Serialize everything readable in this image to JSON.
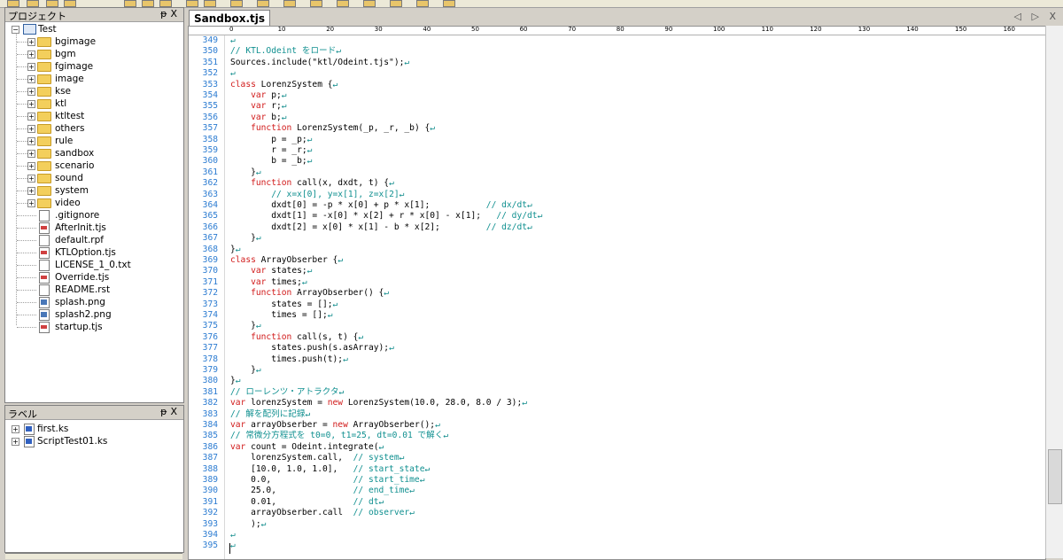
{
  "project_panel": {
    "title": "プロジェクト",
    "pin": "ᵽ",
    "close": "X",
    "root": "Test",
    "folders": [
      "bgimage",
      "bgm",
      "fgimage",
      "image",
      "kse",
      "ktl",
      "ktltest",
      "others",
      "rule",
      "sandbox",
      "scenario",
      "sound",
      "system",
      "video"
    ],
    "files": [
      {
        "name": ".gitignore",
        "kind": "txt"
      },
      {
        "name": "AfterInit.tjs",
        "kind": "tjs"
      },
      {
        "name": "default.rpf",
        "kind": "txt"
      },
      {
        "name": "KTLOption.tjs",
        "kind": "tjs"
      },
      {
        "name": "LICENSE_1_0.txt",
        "kind": "txt"
      },
      {
        "name": "Override.tjs",
        "kind": "tjs"
      },
      {
        "name": "README.rst",
        "kind": "txt"
      },
      {
        "name": "splash.png",
        "kind": "img"
      },
      {
        "name": "splash2.png",
        "kind": "img"
      },
      {
        "name": "startup.tjs",
        "kind": "tjs"
      }
    ]
  },
  "label_panel": {
    "title": "ラベル",
    "pin": "ᵽ",
    "close": "X",
    "items": [
      "first.ks",
      "ScriptTest01.ks"
    ]
  },
  "editor": {
    "tab_label": "Sandbox.tjs",
    "tab_nav": "◁ ▷ X",
    "ruler": [
      "0",
      "10",
      "20",
      "30",
      "40",
      "50",
      "60",
      "70",
      "80",
      "90",
      "100",
      "110",
      "120",
      "130",
      "140",
      "150",
      "160"
    ],
    "lines": [
      {
        "n": "349",
        "segs": [
          {
            "t": "↵",
            "c": "eol"
          }
        ]
      },
      {
        "n": "350",
        "segs": [
          {
            "t": "// KTL.Odeint をロード",
            "c": "cm"
          },
          {
            "t": "↵",
            "c": "eol"
          }
        ]
      },
      {
        "n": "351",
        "segs": [
          {
            "t": "Sources.include(\"ktl/Odeint.tjs\");",
            "c": ""
          },
          {
            "t": "↵",
            "c": "eol"
          }
        ]
      },
      {
        "n": "352",
        "segs": [
          {
            "t": "↵",
            "c": "eol"
          }
        ]
      },
      {
        "n": "353",
        "segs": [
          {
            "t": "class",
            "c": "kw"
          },
          {
            "t": " LorenzSystem {",
            "c": ""
          },
          {
            "t": "↵",
            "c": "eol"
          }
        ]
      },
      {
        "n": "354",
        "segs": [
          {
            "t": "    ",
            "c": ""
          },
          {
            "t": "var",
            "c": "kw"
          },
          {
            "t": " p;",
            "c": ""
          },
          {
            "t": "↵",
            "c": "eol"
          }
        ]
      },
      {
        "n": "355",
        "segs": [
          {
            "t": "    ",
            "c": ""
          },
          {
            "t": "var",
            "c": "kw"
          },
          {
            "t": " r;",
            "c": ""
          },
          {
            "t": "↵",
            "c": "eol"
          }
        ]
      },
      {
        "n": "356",
        "segs": [
          {
            "t": "    ",
            "c": ""
          },
          {
            "t": "var",
            "c": "kw"
          },
          {
            "t": " b;",
            "c": ""
          },
          {
            "t": "↵",
            "c": "eol"
          }
        ]
      },
      {
        "n": "357",
        "segs": [
          {
            "t": "    ",
            "c": ""
          },
          {
            "t": "function",
            "c": "kw"
          },
          {
            "t": " LorenzSystem(_p, _r, _b) {",
            "c": ""
          },
          {
            "t": "↵",
            "c": "eol"
          }
        ]
      },
      {
        "n": "358",
        "segs": [
          {
            "t": "        p = _p;",
            "c": ""
          },
          {
            "t": "↵",
            "c": "eol"
          }
        ]
      },
      {
        "n": "359",
        "segs": [
          {
            "t": "        r = _r;",
            "c": ""
          },
          {
            "t": "↵",
            "c": "eol"
          }
        ]
      },
      {
        "n": "360",
        "segs": [
          {
            "t": "        b = _b;",
            "c": ""
          },
          {
            "t": "↵",
            "c": "eol"
          }
        ]
      },
      {
        "n": "361",
        "segs": [
          {
            "t": "    }",
            "c": ""
          },
          {
            "t": "↵",
            "c": "eol"
          }
        ]
      },
      {
        "n": "362",
        "segs": [
          {
            "t": "    ",
            "c": ""
          },
          {
            "t": "function",
            "c": "kw"
          },
          {
            "t": " call(x, dxdt, t) {",
            "c": ""
          },
          {
            "t": "↵",
            "c": "eol"
          }
        ]
      },
      {
        "n": "363",
        "segs": [
          {
            "t": "        ",
            "c": ""
          },
          {
            "t": "// x=x[0], y=x[1], z=x[2]",
            "c": "cm"
          },
          {
            "t": "↵",
            "c": "eol"
          }
        ]
      },
      {
        "n": "364",
        "segs": [
          {
            "t": "        dxdt[0] = -p * x[0] + p * x[1];           ",
            "c": ""
          },
          {
            "t": "// dx/dt",
            "c": "cm"
          },
          {
            "t": "↵",
            "c": "eol"
          }
        ]
      },
      {
        "n": "365",
        "segs": [
          {
            "t": "        dxdt[1] = -x[0] * x[2] + r * x[0] - x[1];   ",
            "c": ""
          },
          {
            "t": "// dy/dt",
            "c": "cm"
          },
          {
            "t": "↵",
            "c": "eol"
          }
        ]
      },
      {
        "n": "366",
        "segs": [
          {
            "t": "        dxdt[2] = x[0] * x[1] - b * x[2];         ",
            "c": ""
          },
          {
            "t": "// dz/dt",
            "c": "cm"
          },
          {
            "t": "↵",
            "c": "eol"
          }
        ]
      },
      {
        "n": "367",
        "segs": [
          {
            "t": "    }",
            "c": ""
          },
          {
            "t": "↵",
            "c": "eol"
          }
        ]
      },
      {
        "n": "368",
        "segs": [
          {
            "t": "}",
            "c": ""
          },
          {
            "t": "↵",
            "c": "eol"
          }
        ]
      },
      {
        "n": "369",
        "segs": [
          {
            "t": "class",
            "c": "kw"
          },
          {
            "t": " ArrayObserber {",
            "c": ""
          },
          {
            "t": "↵",
            "c": "eol"
          }
        ]
      },
      {
        "n": "370",
        "segs": [
          {
            "t": "    ",
            "c": ""
          },
          {
            "t": "var",
            "c": "kw"
          },
          {
            "t": " states;",
            "c": ""
          },
          {
            "t": "↵",
            "c": "eol"
          }
        ]
      },
      {
        "n": "371",
        "segs": [
          {
            "t": "    ",
            "c": ""
          },
          {
            "t": "var",
            "c": "kw"
          },
          {
            "t": " times;",
            "c": ""
          },
          {
            "t": "↵",
            "c": "eol"
          }
        ]
      },
      {
        "n": "372",
        "segs": [
          {
            "t": "    ",
            "c": ""
          },
          {
            "t": "function",
            "c": "kw"
          },
          {
            "t": " ArrayObserber() {",
            "c": ""
          },
          {
            "t": "↵",
            "c": "eol"
          }
        ]
      },
      {
        "n": "373",
        "segs": [
          {
            "t": "        states = [];",
            "c": ""
          },
          {
            "t": "↵",
            "c": "eol"
          }
        ]
      },
      {
        "n": "374",
        "segs": [
          {
            "t": "        times = [];",
            "c": ""
          },
          {
            "t": "↵",
            "c": "eol"
          }
        ]
      },
      {
        "n": "375",
        "segs": [
          {
            "t": "    }",
            "c": ""
          },
          {
            "t": "↵",
            "c": "eol"
          }
        ]
      },
      {
        "n": "376",
        "segs": [
          {
            "t": "    ",
            "c": ""
          },
          {
            "t": "function",
            "c": "kw"
          },
          {
            "t": " call(s, t) {",
            "c": ""
          },
          {
            "t": "↵",
            "c": "eol"
          }
        ]
      },
      {
        "n": "377",
        "segs": [
          {
            "t": "        states.push(s.asArray);",
            "c": ""
          },
          {
            "t": "↵",
            "c": "eol"
          }
        ]
      },
      {
        "n": "378",
        "segs": [
          {
            "t": "        times.push(t);",
            "c": ""
          },
          {
            "t": "↵",
            "c": "eol"
          }
        ]
      },
      {
        "n": "379",
        "segs": [
          {
            "t": "    }",
            "c": ""
          },
          {
            "t": "↵",
            "c": "eol"
          }
        ]
      },
      {
        "n": "380",
        "segs": [
          {
            "t": "}",
            "c": ""
          },
          {
            "t": "↵",
            "c": "eol"
          }
        ]
      },
      {
        "n": "381",
        "segs": [
          {
            "t": "// ローレンツ・アトラクタ",
            "c": "cm"
          },
          {
            "t": "↵",
            "c": "eol"
          }
        ]
      },
      {
        "n": "382",
        "segs": [
          {
            "t": "var",
            "c": "kw"
          },
          {
            "t": " lorenzSystem = ",
            "c": ""
          },
          {
            "t": "new",
            "c": "kw"
          },
          {
            "t": " LorenzSystem(10.0, 28.0, 8.0 / 3);",
            "c": ""
          },
          {
            "t": "↵",
            "c": "eol"
          }
        ]
      },
      {
        "n": "383",
        "segs": [
          {
            "t": "// 解を配列に記録",
            "c": "cm"
          },
          {
            "t": "↵",
            "c": "eol"
          }
        ]
      },
      {
        "n": "384",
        "segs": [
          {
            "t": "var",
            "c": "kw"
          },
          {
            "t": " arrayObserber = ",
            "c": ""
          },
          {
            "t": "new",
            "c": "kw"
          },
          {
            "t": " ArrayObserber();",
            "c": ""
          },
          {
            "t": "↵",
            "c": "eol"
          }
        ]
      },
      {
        "n": "385",
        "segs": [
          {
            "t": "// 常微分方程式を t0=0, t1=25, dt=0.01 で解く",
            "c": "cm"
          },
          {
            "t": "↵",
            "c": "eol"
          }
        ]
      },
      {
        "n": "386",
        "segs": [
          {
            "t": "var",
            "c": "kw"
          },
          {
            "t": " count = Odeint.integrate(",
            "c": ""
          },
          {
            "t": "↵",
            "c": "eol"
          }
        ]
      },
      {
        "n": "387",
        "segs": [
          {
            "t": "    lorenzSystem.call,  ",
            "c": ""
          },
          {
            "t": "// system",
            "c": "cm"
          },
          {
            "t": "↵",
            "c": "eol"
          }
        ]
      },
      {
        "n": "388",
        "segs": [
          {
            "t": "    [10.0, 1.0, 1.0],   ",
            "c": ""
          },
          {
            "t": "// start_state",
            "c": "cm"
          },
          {
            "t": "↵",
            "c": "eol"
          }
        ]
      },
      {
        "n": "389",
        "segs": [
          {
            "t": "    0.0,                ",
            "c": ""
          },
          {
            "t": "// start_time",
            "c": "cm"
          },
          {
            "t": "↵",
            "c": "eol"
          }
        ]
      },
      {
        "n": "390",
        "segs": [
          {
            "t": "    25.0,               ",
            "c": ""
          },
          {
            "t": "// end_time",
            "c": "cm"
          },
          {
            "t": "↵",
            "c": "eol"
          }
        ]
      },
      {
        "n": "391",
        "segs": [
          {
            "t": "    0.01,               ",
            "c": ""
          },
          {
            "t": "// dt",
            "c": "cm"
          },
          {
            "t": "↵",
            "c": "eol"
          }
        ]
      },
      {
        "n": "392",
        "segs": [
          {
            "t": "    arrayObserber.call  ",
            "c": ""
          },
          {
            "t": "// observer",
            "c": "cm"
          },
          {
            "t": "↵",
            "c": "eol"
          }
        ]
      },
      {
        "n": "393",
        "segs": [
          {
            "t": "    );",
            "c": ""
          },
          {
            "t": "↵",
            "c": "eol"
          }
        ]
      },
      {
        "n": "394",
        "segs": [
          {
            "t": "↵",
            "c": "eol"
          }
        ]
      },
      {
        "n": "395",
        "segs": [
          {
            "t": "↵",
            "c": "eol"
          }
        ]
      }
    ]
  }
}
